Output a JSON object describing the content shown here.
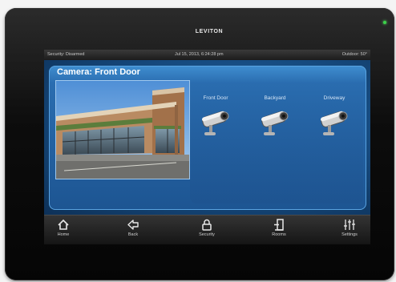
{
  "device": {
    "brand": "LEVITON"
  },
  "status_bar": {
    "security": "Security: Disarmed",
    "datetime": "Jul 15, 2013, 6:24:28 pm",
    "outdoor": "Outdoor: 50°"
  },
  "camera_panel": {
    "title": "Camera: Front Door",
    "cameras": [
      {
        "label": "Front Door",
        "icon": "security-camera-icon"
      },
      {
        "label": "Backyard",
        "icon": "security-camera-icon"
      },
      {
        "label": "Driveway",
        "icon": "security-camera-icon"
      }
    ]
  },
  "nav": {
    "items": [
      {
        "label": "Home",
        "icon": "home-icon"
      },
      {
        "label": "Back",
        "icon": "back-arrow-icon"
      },
      {
        "label": "Security",
        "icon": "lock-icon"
      },
      {
        "label": "Rooms",
        "icon": "door-icon"
      },
      {
        "label": "Settings",
        "icon": "sliders-icon"
      }
    ]
  },
  "colors": {
    "accent": "#2a6db0",
    "led": "#3cd24a",
    "bezel": "#0d0d0d"
  }
}
